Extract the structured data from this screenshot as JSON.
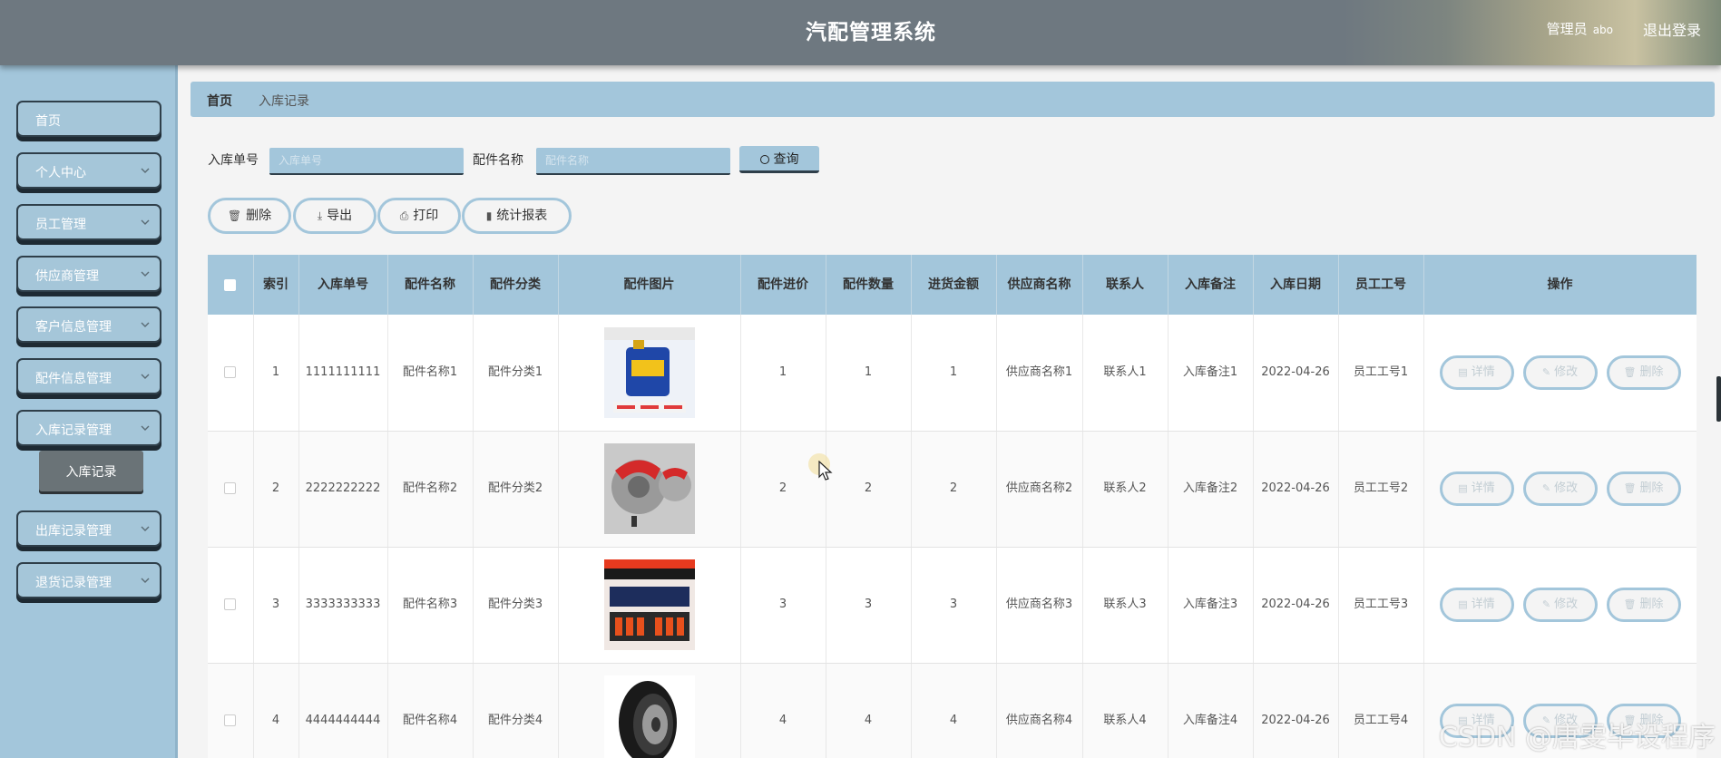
{
  "header": {
    "title": "汽配管理系统",
    "user_role": "管理员",
    "user_name": "abo",
    "logout": "退出登录"
  },
  "sidebar": {
    "items": [
      {
        "label": "首页",
        "has_children": false
      },
      {
        "label": "个人中心",
        "has_children": true
      },
      {
        "label": "员工管理",
        "has_children": true
      },
      {
        "label": "供应商管理",
        "has_children": true
      },
      {
        "label": "客户信息管理",
        "has_children": true
      },
      {
        "label": "配件信息管理",
        "has_children": true
      },
      {
        "label": "入库记录管理",
        "has_children": true
      },
      {
        "label": "出库记录管理",
        "has_children": true
      },
      {
        "label": "退货记录管理",
        "has_children": true
      }
    ],
    "active_sub": "入库记录"
  },
  "breadcrumb": {
    "home": "首页",
    "current": "入库记录"
  },
  "search": {
    "field1_label": "入库单号",
    "field1_placeholder": "入库单号",
    "field2_label": "配件名称",
    "field2_placeholder": "配件名称",
    "button": "查询"
  },
  "actions": {
    "delete": "删除",
    "export": "导出",
    "print": "打印",
    "report": "统计报表"
  },
  "table": {
    "headers": [
      "索引",
      "入库单号",
      "配件名称",
      "配件分类",
      "配件图片",
      "配件进价",
      "配件数量",
      "进货金额",
      "供应商名称",
      "联系人",
      "入库备注",
      "入库日期",
      "员工工号",
      "操作"
    ],
    "ops": {
      "detail": "详情",
      "edit": "修改",
      "delete": "删除"
    },
    "rows": [
      {
        "index": "1",
        "no": "1111111111",
        "name": "配件名称1",
        "category": "配件分类1",
        "image": "engine-oil-can",
        "price": "1",
        "qty": "1",
        "amount": "1",
        "supplier": "供应商名称1",
        "contact": "联系人1",
        "remark": "入库备注1",
        "date": "2022-04-26",
        "staff": "员工工号1"
      },
      {
        "index": "2",
        "no": "2222222222",
        "name": "配件名称2",
        "category": "配件分类2",
        "image": "brake-caliper",
        "price": "2",
        "qty": "2",
        "amount": "2",
        "supplier": "供应商名称2",
        "contact": "联系人2",
        "remark": "入库备注2",
        "date": "2022-04-26",
        "staff": "员工工号2"
      },
      {
        "index": "3",
        "no": "3333333333",
        "name": "配件名称3",
        "category": "配件分类3",
        "image": "spark-plug-box",
        "price": "3",
        "qty": "3",
        "amount": "3",
        "supplier": "供应商名称3",
        "contact": "联系人3",
        "remark": "入库备注3",
        "date": "2022-04-26",
        "staff": "员工工号3"
      },
      {
        "index": "4",
        "no": "4444444444",
        "name": "配件名称4",
        "category": "配件分类4",
        "image": "tire",
        "price": "4",
        "qty": "4",
        "amount": "4",
        "supplier": "供应商名称4",
        "contact": "联系人4",
        "remark": "入库备注4",
        "date": "2022-04-26",
        "staff": "员工工号4"
      }
    ]
  },
  "watermark": "CSDN @唐雯毕设程序",
  "colors": {
    "accent": "#a3c6db",
    "header": "#6e7880",
    "dark_border": "#2f3f4a"
  }
}
